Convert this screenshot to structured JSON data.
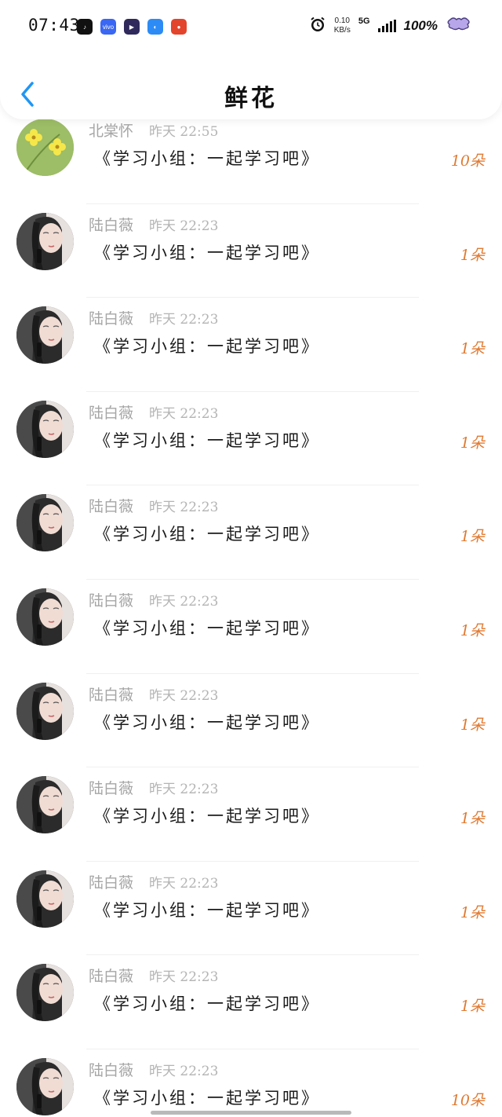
{
  "status_bar": {
    "time": "07:43",
    "app_icons": [
      {
        "name": "tiktok-icon",
        "color": "#111111",
        "glyph": "♪"
      },
      {
        "name": "vivo-icon",
        "color": "#3a67f3",
        "glyph": "vivo"
      },
      {
        "name": "video-player-icon",
        "color": "#2f2a5b",
        "glyph": "▶"
      },
      {
        "name": "browser-icon",
        "color": "#2d8bf5",
        "glyph": "◐"
      },
      {
        "name": "shopping-icon",
        "color": "#e2452c",
        "glyph": "●"
      }
    ],
    "speed_value": "0.10",
    "speed_unit": "KB/s",
    "network": "5G",
    "battery": "100%"
  },
  "nav": {
    "title": "鲜花"
  },
  "colors": {
    "accent_blue": "#2196f3",
    "count_orange": "#e07a32"
  },
  "list": [
    {
      "sender": "北棠怀",
      "time": "昨天 22:55",
      "message": "《学习小组：一起学习吧》",
      "count": "10朵",
      "avatar": "flower"
    },
    {
      "sender": "陆白薇",
      "time": "昨天 22:23",
      "message": "《学习小组：一起学习吧》",
      "count": "1朵",
      "avatar": "portrait"
    },
    {
      "sender": "陆白薇",
      "time": "昨天 22:23",
      "message": "《学习小组：一起学习吧》",
      "count": "1朵",
      "avatar": "portrait"
    },
    {
      "sender": "陆白薇",
      "time": "昨天 22:23",
      "message": "《学习小组：一起学习吧》",
      "count": "1朵",
      "avatar": "portrait"
    },
    {
      "sender": "陆白薇",
      "time": "昨天 22:23",
      "message": "《学习小组：一起学习吧》",
      "count": "1朵",
      "avatar": "portrait"
    },
    {
      "sender": "陆白薇",
      "time": "昨天 22:23",
      "message": "《学习小组：一起学习吧》",
      "count": "1朵",
      "avatar": "portrait"
    },
    {
      "sender": "陆白薇",
      "time": "昨天 22:23",
      "message": "《学习小组：一起学习吧》",
      "count": "1朵",
      "avatar": "portrait"
    },
    {
      "sender": "陆白薇",
      "time": "昨天 22:23",
      "message": "《学习小组：一起学习吧》",
      "count": "1朵",
      "avatar": "portrait"
    },
    {
      "sender": "陆白薇",
      "time": "昨天 22:23",
      "message": "《学习小组：一起学习吧》",
      "count": "1朵",
      "avatar": "portrait"
    },
    {
      "sender": "陆白薇",
      "time": "昨天 22:23",
      "message": "《学习小组：一起学习吧》",
      "count": "1朵",
      "avatar": "portrait"
    },
    {
      "sender": "陆白薇",
      "time": "昨天 22:23",
      "message": "《学习小组：一起学习吧》",
      "count": "10朵",
      "avatar": "portrait"
    }
  ]
}
